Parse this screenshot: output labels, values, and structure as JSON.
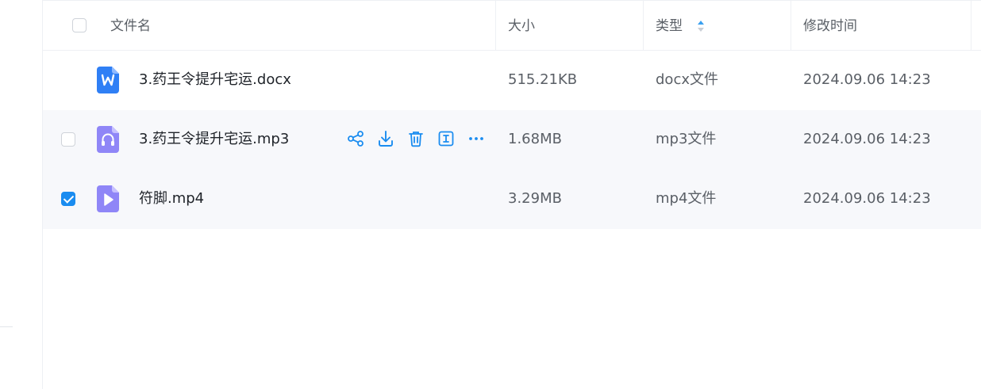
{
  "header": {
    "name": "文件名",
    "size": "大小",
    "type": "类型",
    "modified": "修改时间"
  },
  "files": [
    {
      "name": "3.药王令提升宅运.docx",
      "size": "515.21KB",
      "type": "docx文件",
      "modified": "2024.09.06 14:23",
      "icon": "word-file-icon",
      "selected": false
    },
    {
      "name": "3.药王令提升宅运.mp3",
      "size": "1.68MB",
      "type": "mp3文件",
      "modified": "2024.09.06 14:23",
      "icon": "audio-file-icon",
      "selected": false
    },
    {
      "name": "符脚.mp4",
      "size": "3.29MB",
      "type": "mp4文件",
      "modified": "2024.09.06 14:23",
      "icon": "video-file-icon",
      "selected": true
    }
  ],
  "row_actions": [
    "share-icon",
    "download-icon",
    "delete-icon",
    "rename-icon",
    "more-icon"
  ],
  "colors": {
    "accent": "#1a8cf0",
    "word": "#2f7ff5",
    "media": "#8f86f7",
    "hover_row": "#f7f8fb"
  }
}
